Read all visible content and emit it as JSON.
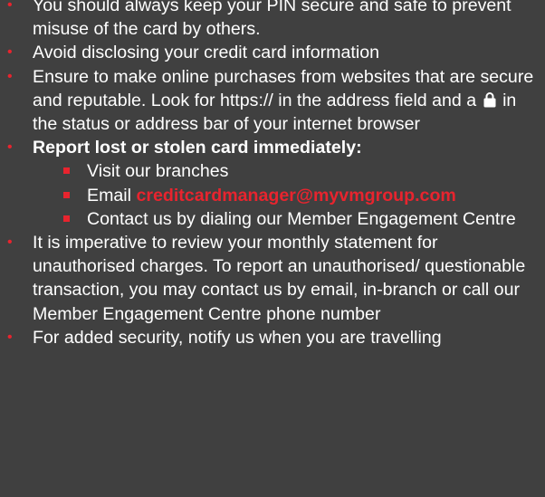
{
  "colors": {
    "background": "#404040",
    "accent": "#e8242e",
    "text": "#ffffff"
  },
  "tips": [
    {
      "text": "You should always keep your PIN secure and safe to prevent misuse of the card by others."
    },
    {
      "text": "Avoid disclosing your credit card information"
    },
    {
      "text_before_icon": "Ensure to make online purchases from websites that are secure and reputable. Look for https:// in the address field and a",
      "icon": "padlock-icon",
      "text_after_icon": "in the status or address bar of your internet browser"
    },
    {
      "heading": "Report lost or stolen card immediately:",
      "subitems": [
        {
          "text": "Visit our branches"
        },
        {
          "prefix": "Email",
          "email": "creditcardmanager@myvmgroup.com"
        },
        {
          "text": "Contact us by dialing our Member Engagement Centre"
        }
      ]
    },
    {
      "text": "It is imperative to review your monthly statement for unauthorised charges. To report an unauthorised/ questionable transaction, you may contact us by email, in-branch or call  our Member Engagement Centre phone number"
    },
    {
      "text": "For added security, notify us when you are travelling"
    }
  ]
}
